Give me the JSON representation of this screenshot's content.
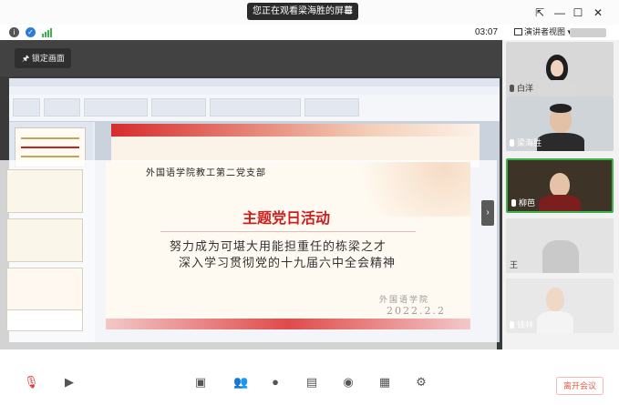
{
  "top": {
    "banner_text": "您正在观看梁海胜的屏幕",
    "timer": "03:07",
    "presenter_view": "演讲者视图"
  },
  "stage": {
    "lock_label": "锁定画面"
  },
  "slide": {
    "header": "外国语学院教工第二党支部",
    "title": "主题党日活动",
    "line1": "努力成为可堪大用能担重任的栋梁之才",
    "line2": "深入学习贯彻党的十九届六中全会精神",
    "signature": "外国语学院",
    "date": "2022.2.2"
  },
  "participants": [
    {
      "name": "白洋"
    },
    {
      "name": "梁海胜"
    },
    {
      "name": "柳芭"
    },
    {
      "name": "王"
    },
    {
      "name": "钱林"
    }
  ],
  "toolbar": {
    "end_label": "离开会议"
  },
  "icons": {
    "info": "info-icon",
    "shield": "shield-icon",
    "signal": "signal-icon",
    "menu": "menu-icon",
    "pin": "pin-icon"
  },
  "colors": {
    "accent_red": "#cc1e1e",
    "end_red": "#e45c4a",
    "green": "#3bb24a",
    "blue": "#2f7bd9"
  }
}
